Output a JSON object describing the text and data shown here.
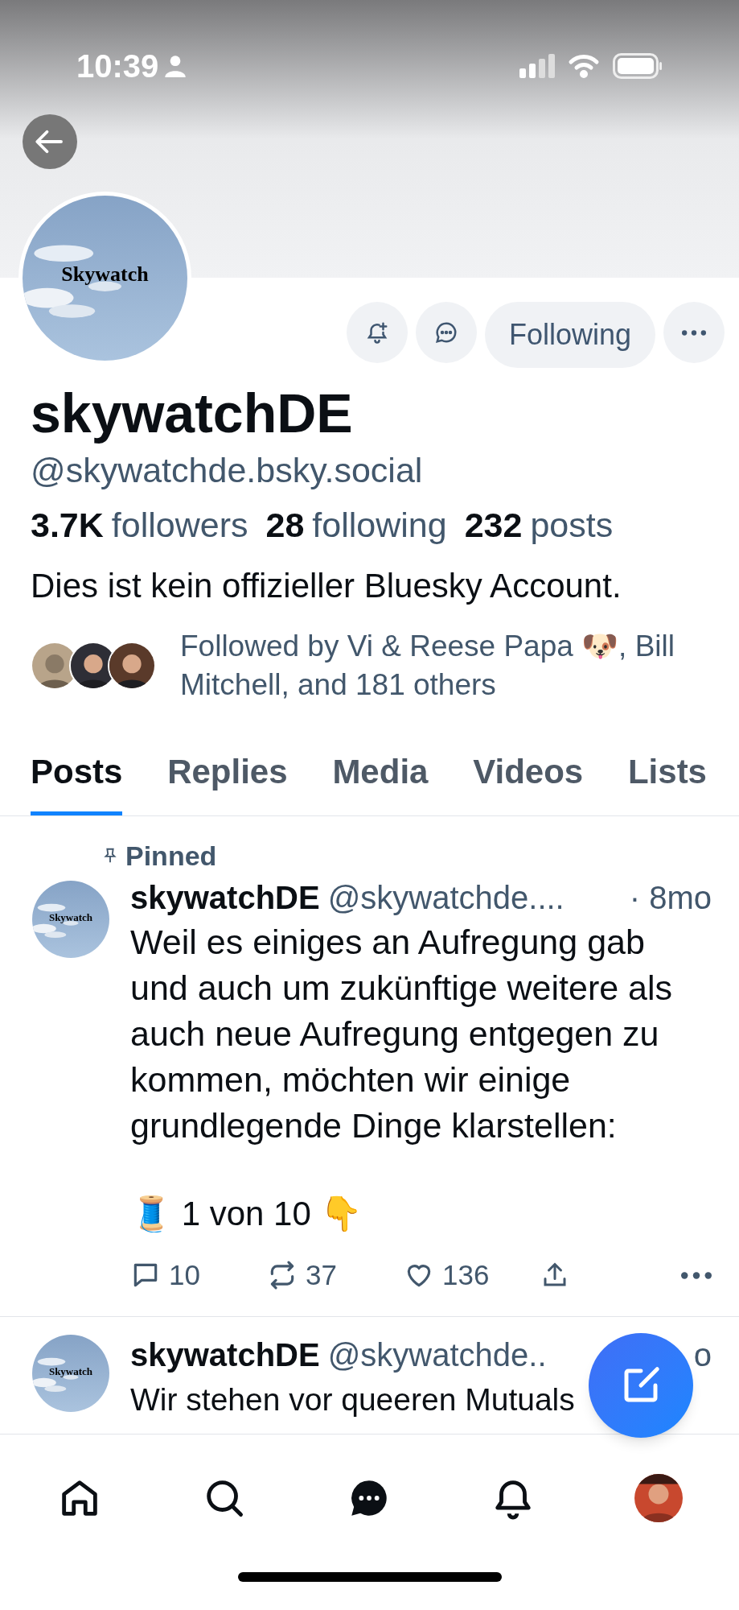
{
  "status_bar": {
    "time": "10:39"
  },
  "profile": {
    "avatar_label": "Skywatch",
    "actions": [
      {
        "kind": "notify"
      },
      {
        "kind": "message"
      },
      {
        "kind": "text",
        "label": "Following"
      },
      {
        "kind": "more"
      }
    ],
    "name": "skywatchDE",
    "handle": "@skywatchde.bsky.social",
    "stats": [
      {
        "count": "3.7K",
        "label": "followers"
      },
      {
        "count": "28",
        "label": "following"
      },
      {
        "count": "232",
        "label": "posts"
      }
    ],
    "bio": "Dies ist kein offizieller Bluesky Account.",
    "followed_by": "Followed by Vi & Reese Papa 🐶, Bill Mitchell, and 181 others"
  },
  "tabs": [
    {
      "label": "Posts",
      "selected": true
    },
    {
      "label": "Replies",
      "selected": false
    },
    {
      "label": "Media",
      "selected": false
    },
    {
      "label": "Videos",
      "selected": false
    },
    {
      "label": "Lists",
      "selected": false
    }
  ],
  "posts": [
    {
      "pinned_label": "Pinned",
      "avatar_label": "Skywatch",
      "name": "skywatchDE",
      "handle": "@skywatchde....",
      "time": "· 8mo",
      "body": "Weil es einiges an Aufregung gab und auch um zukünftige weitere als auch neue Aufregung entgegen zu kommen, möchten wir einige grundlegende Dinge klarstellen:",
      "thread": "🧵 1 von 10 👇",
      "replies": "10",
      "reposts": "37",
      "likes": "136"
    },
    {
      "avatar_label": "Skywatch",
      "name": "skywatchDE",
      "handle": "@skywatchde..",
      "time": "o",
      "body": "Wir stehen vor queeren Mutuals"
    }
  ],
  "nav": [
    {
      "kind": "home"
    },
    {
      "kind": "search"
    },
    {
      "kind": "chat"
    },
    {
      "kind": "bell"
    },
    {
      "kind": "profile"
    }
  ]
}
